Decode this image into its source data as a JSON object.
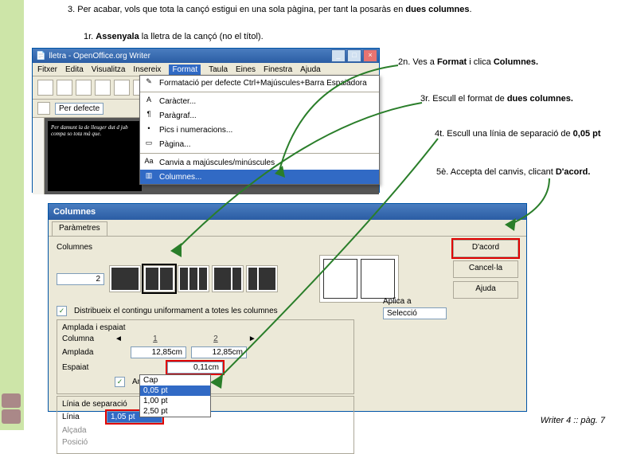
{
  "instructions": {
    "step3": "3. Per acabar, vols que tota la cançó estigui en una sola pàgina, per tant la posaràs en ",
    "step3_b": "dues columnes",
    "step3_end": ".",
    "s1r": "1r. ",
    "s1r_b": "Assenyala",
    "s1r_end": " la lletra de la cançó (no el títol).",
    "s2n": "2n. Ves a ",
    "s2n_b1": "Format",
    "s2n_mid": " i clica ",
    "s2n_b2": "Columnes.",
    "s3r": "3r. Escull el format de ",
    "s3r_b": "dues columnes.",
    "s4t": "4t. Escull una línia de separació de ",
    "s4t_b": "0,05 pt",
    "s5e": "5è. Accepta del canvis, clicant ",
    "s5e_b": "D'acord."
  },
  "writer": {
    "title": "lletra - OpenOffice.org Writer",
    "menus": [
      "Fitxer",
      "Edita",
      "Visualitza",
      "Insereix",
      "Format",
      "Taula",
      "Eines",
      "Finestra",
      "Ajuda"
    ],
    "style_default": "Per defecte",
    "doc_text": "Per damunt la de\nlleuger dut d\njub compa so\ntota mà que."
  },
  "format_menu": {
    "items": [
      "Formatació per defecte  Ctrl+Majúscules+Barra Espaiadora",
      "Caràcter...",
      "Paràgraf...",
      "Pics i numeracions...",
      "Pàgina...",
      "Canvia a majúscules/minúscules",
      "Columnes..."
    ]
  },
  "dialog": {
    "title": "Columnes",
    "tab": "Paràmetres",
    "columns_lbl": "Columnes",
    "columns_val": "2",
    "distribute": "Distribueix el contingu   uniformament a totes les columnes",
    "width_spacing": "Amplada i espaiat",
    "col_lbl": "Columna",
    "col1": "1",
    "col2": "2",
    "width_lbl": "Amplada",
    "w1": "12,85cm",
    "w2": "12,85cm",
    "spacing_lbl": "Espaiat",
    "sp1": "0,11cm",
    "auto_width": "Amplada automàtica",
    "sep_line": "Línia de separació",
    "line_lbl": "Línia",
    "line_val": "1,05 pt",
    "height_lbl": "Alçada",
    "pos_lbl": "Posició",
    "apply_lbl": "Aplica a",
    "apply_val": "Selecció",
    "btn_ok": "D'acord",
    "btn_cancel": "Cancel·la",
    "btn_help": "Ajuda"
  },
  "line_dropdown": [
    "Cap",
    "0,05 pt",
    "1,00 pt",
    "2,50 pt"
  ],
  "footer": "Writer 4 :: pàg. 7"
}
